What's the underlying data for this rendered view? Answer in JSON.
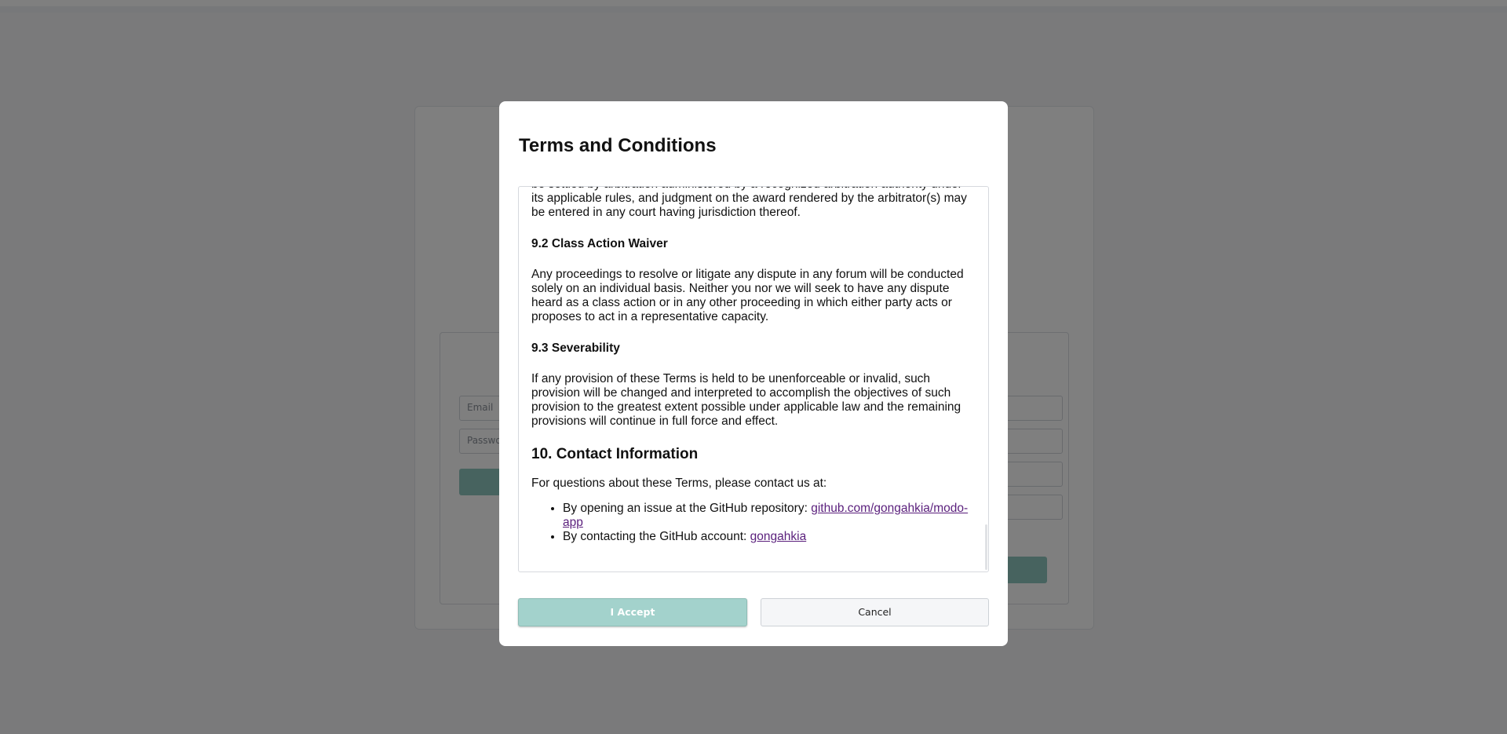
{
  "background": {
    "email_placeholder": "Email",
    "password_placeholder": "Passwo"
  },
  "modal": {
    "title": "Terms and Conditions",
    "terms": {
      "arbitration_tail": "be settled by arbitration administered by a recognized arbitration authority under its applicable rules, and judgment on the award rendered by the arbitrator(s) may be entered in any court having jurisdiction thereof.",
      "class_action_heading": "9.2 Class Action Waiver",
      "class_action_text": "Any proceedings to resolve or litigate any dispute in any forum will be conducted solely on an individual basis. Neither you nor we will seek to have any dispute heard as a class action or in any other proceeding in which either party acts or proposes to act in a representative capacity.",
      "severability_heading": "9.3 Severability",
      "severability_text": "If any provision of these Terms is held to be unenforceable or invalid, such provision will be changed and interpreted to accomplish the objectives of such provision to the greatest extent possible under applicable law and the remaining provisions will continue in full force and effect.",
      "contact_heading": "10. Contact Information",
      "contact_intro": "For questions about these Terms, please contact us at:",
      "contact_item1_text": "By opening an issue at the GitHub repository: ",
      "contact_item1_link": "github.com/gongahkia/modo-app",
      "contact_item2_text": "By contacting the GitHub account: ",
      "contact_item2_link": "gongahkia"
    },
    "accept_label": "I Accept",
    "cancel_label": "Cancel"
  },
  "colors": {
    "overlay": "rgba(0,0,0,0.5)",
    "accept_bg": "#a3d2cc",
    "link": "#5a1f7c"
  }
}
